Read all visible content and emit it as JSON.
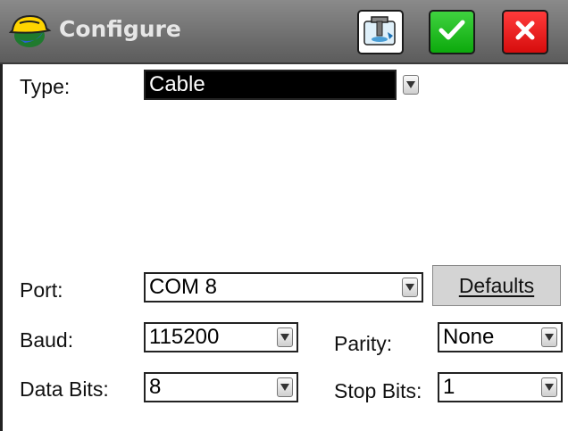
{
  "window": {
    "title": "Configure",
    "icons": {
      "app": "surveyor-hardhat-globe-icon",
      "tool": "receiver-settings-icon",
      "ok": "checkmark-icon",
      "cancel": "close-x-icon"
    },
    "colors": {
      "titlebar": "#6e6e6e",
      "ok": "#0ca90c",
      "cancel": "#d60d0d"
    }
  },
  "form": {
    "type": {
      "label": "Type:",
      "value": "Cable"
    },
    "port": {
      "label": "Port:",
      "value": "COM 8"
    },
    "defaults_button": "Defaults",
    "baud": {
      "label": "Baud:",
      "value": "115200"
    },
    "parity": {
      "label": "Parity:",
      "value": "None"
    },
    "data_bits": {
      "label": "Data Bits:",
      "value": "8"
    },
    "stop_bits": {
      "label": "Stop Bits:",
      "value": "1"
    }
  }
}
